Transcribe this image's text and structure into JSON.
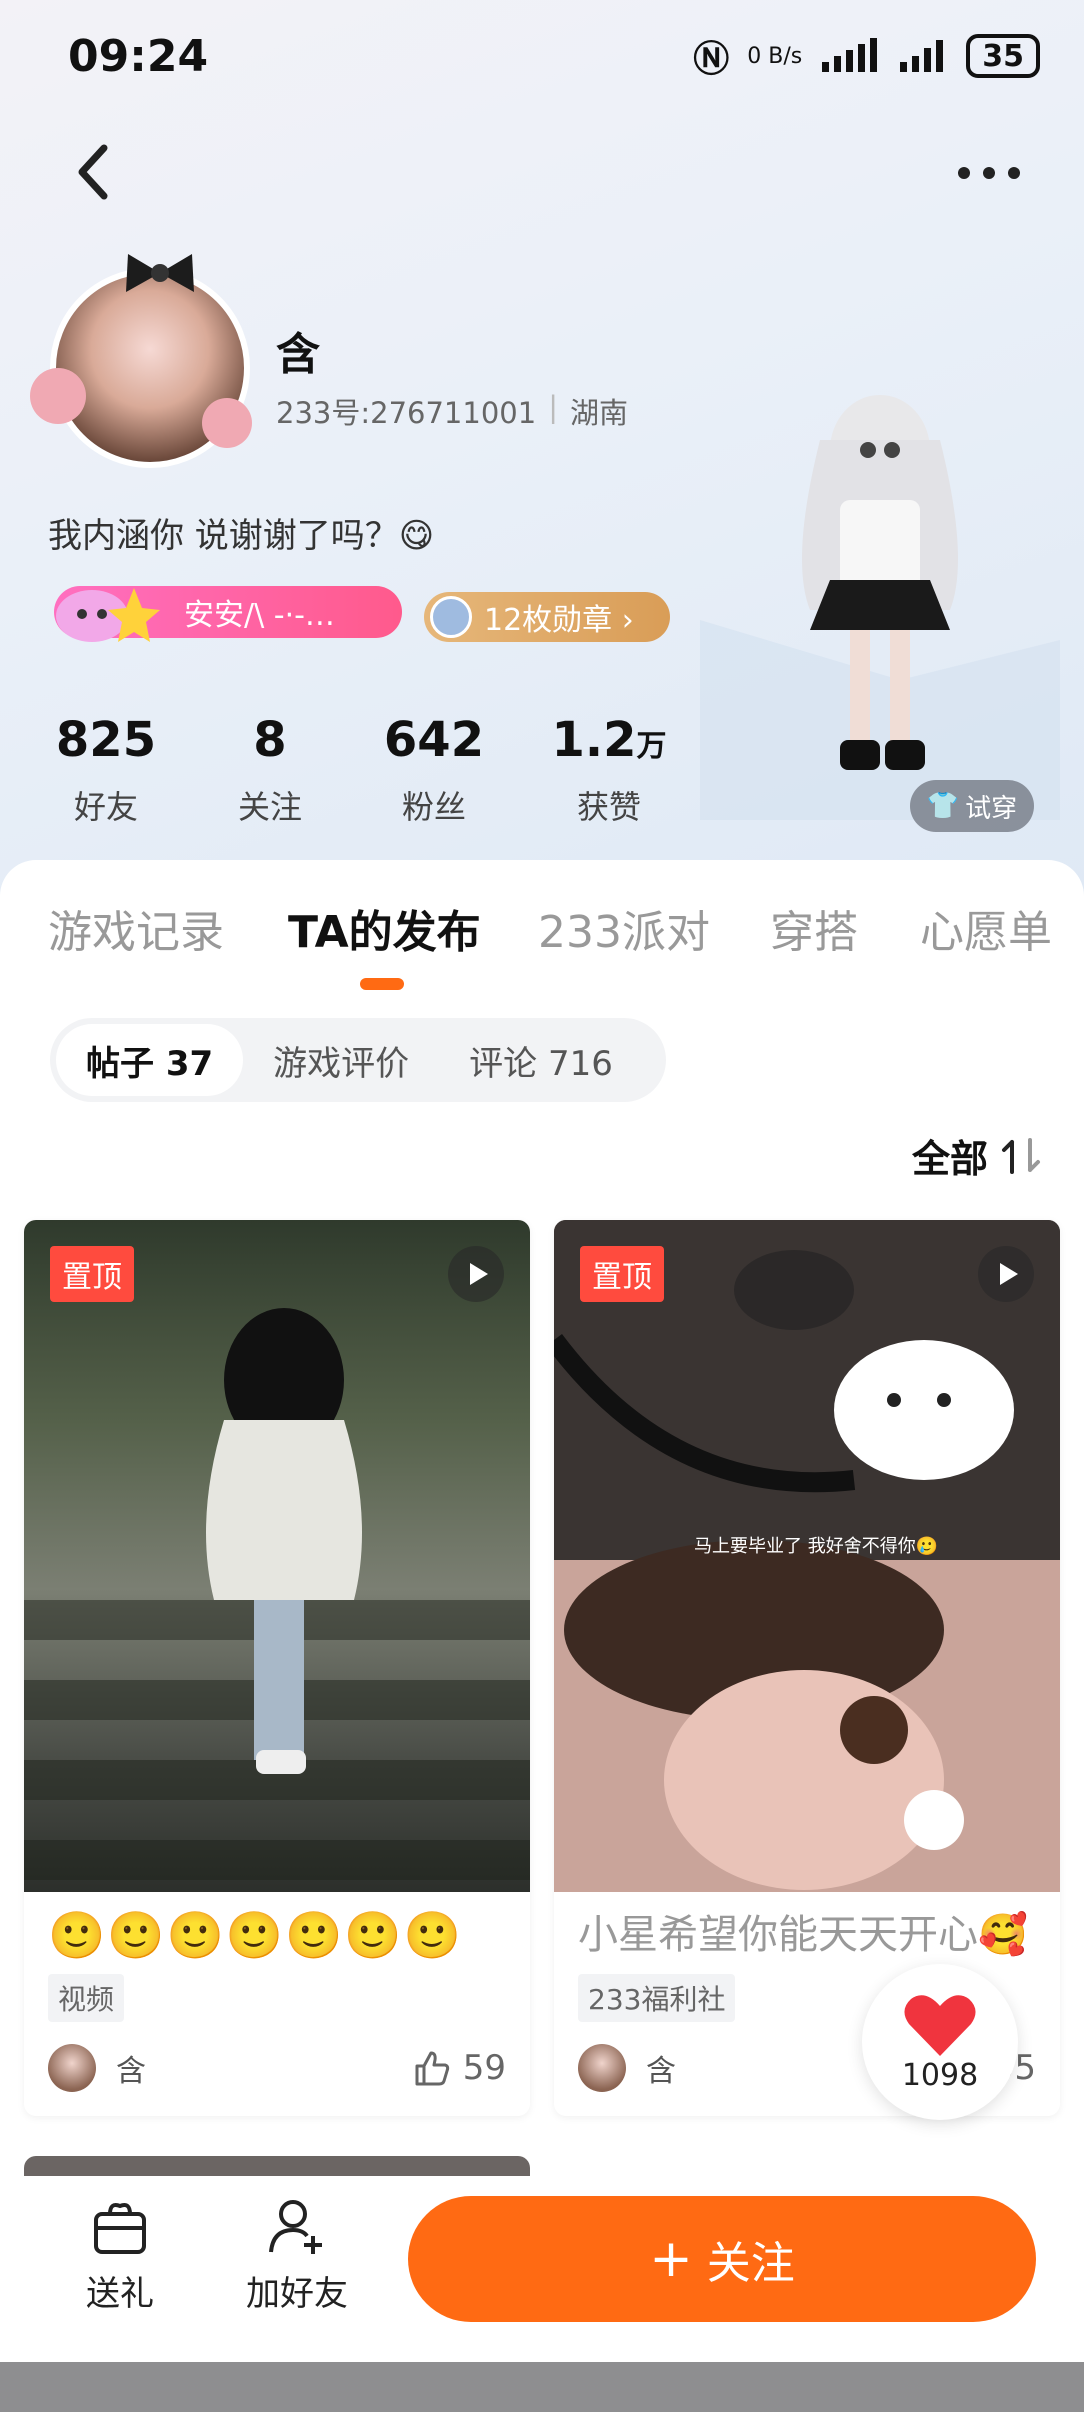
{
  "status_bar": {
    "time": "09:24",
    "net_speed": "0 B/s",
    "battery": "35"
  },
  "profile": {
    "name": "含",
    "uid": "233号:276711001",
    "region": "湖南",
    "bio": "我内涵你 说谢谢了吗？😋",
    "tag_name": "安安/\\ -·-…",
    "medals": "12枚勋章 ›",
    "try_on": "试穿"
  },
  "stats": [
    {
      "value": "825",
      "unit": "",
      "label": "好友"
    },
    {
      "value": "8",
      "unit": "",
      "label": "关注"
    },
    {
      "value": "642",
      "unit": "",
      "label": "粉丝"
    },
    {
      "value": "1.2",
      "unit": "万",
      "label": "获赞"
    }
  ],
  "tabs": [
    "游戏记录",
    "TA的发布",
    "233派对",
    "穿搭",
    "心愿单"
  ],
  "subtabs": [
    "帖子 37",
    "游戏评价",
    "评论 716"
  ],
  "sort_label": "全部",
  "posts": [
    {
      "pinned": "置顶",
      "title": "🙂🙂🙂🙂🙂🙂🙂",
      "chip": "视频",
      "author": "含",
      "likes": "59",
      "overlay": ""
    },
    {
      "pinned": "置顶",
      "title": "小星希望你能天天开心🥰",
      "chip": "233福利社",
      "author": "含",
      "likes": "55",
      "overlay": "马上要毕业了 我好舍不得你🥲"
    }
  ],
  "floating_likes": "1098",
  "bottom": {
    "gift": "送礼",
    "add_friend": "加好友",
    "follow": "关注"
  },
  "colors": {
    "accent": "#ff6a13",
    "pin": "#ff4b3e",
    "tag_pink": "#ff5a8c",
    "tag_gold": "#d99d57"
  }
}
